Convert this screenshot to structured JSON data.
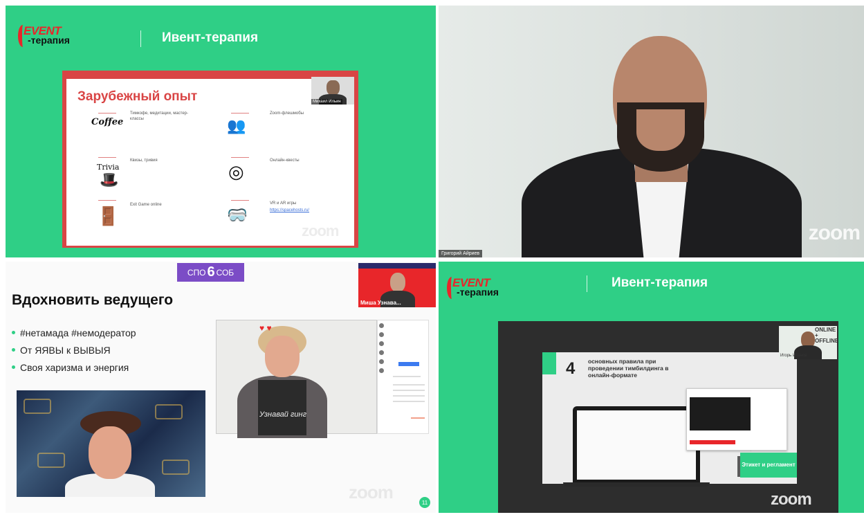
{
  "brand": {
    "logo_top": "EVENT",
    "logo_bottom": "-терапия",
    "title": "Ивент-терапия"
  },
  "zoom_watermark": "zoom",
  "tile1": {
    "slide_title": "Зарубежный опыт",
    "items": [
      {
        "icon": "Coffee",
        "text": "Тимкофе, медитации, мастер-классы"
      },
      {
        "icon": "Trivia",
        "text": "Квизы, тривия"
      },
      {
        "icon": "",
        "text": "Exit Game online"
      },
      {
        "icon": "",
        "text": "Zoom-флешмобы"
      },
      {
        "icon": "",
        "text": "Онлайн-квесты"
      },
      {
        "icon": "",
        "text": "VR и AR игры"
      }
    ],
    "link_text": "https://spacehosts.ru/",
    "pip_name": "Михаил Ильин"
  },
  "tile2": {
    "participant_name": "Григорий Айриев"
  },
  "tile3": {
    "badge_left": "СПО",
    "badge_num": "6",
    "badge_right": "СОБ",
    "title": "Вдохновить ведущего",
    "bullets": [
      "#нетамада #немодератор",
      "От ЯЯВЫ к ВЫВЫЯ",
      "Своя харизма и энергия"
    ],
    "pip_name": "Миша Узнава...",
    "shirt_text": "Узнавай гинг",
    "page_number": "11"
  },
  "tile4": {
    "slide_number": "4",
    "slide_heading": "основных правила при проведении тимбилдинга в онлайн-формате",
    "caption": "Этикет и регламент",
    "pip_name": "Игорь Иванов",
    "pip_banner": "ONLINE + OFFLINE"
  }
}
